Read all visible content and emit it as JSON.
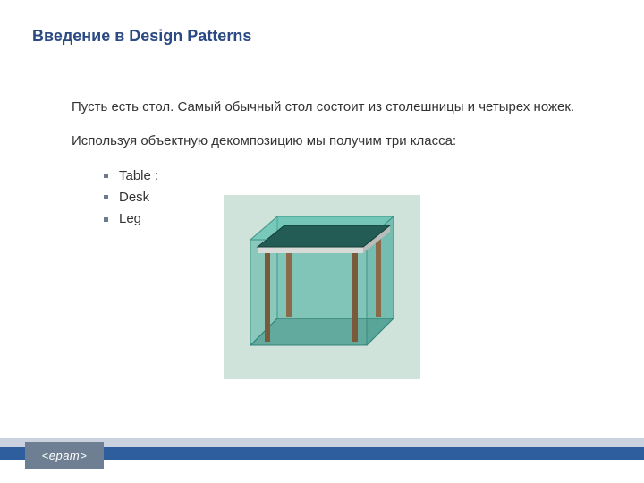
{
  "title": "Введение в Design Patterns",
  "paragraph1": "Пусть есть стол. Самый обычный стол состоит из столешницы и четырех ножек.",
  "paragraph2": "Используя объектную декомпозицию мы получим три класса:",
  "list": {
    "item1": "Table :",
    "item2": "Desk",
    "item3": "Leg"
  },
  "logo": "<epam>"
}
